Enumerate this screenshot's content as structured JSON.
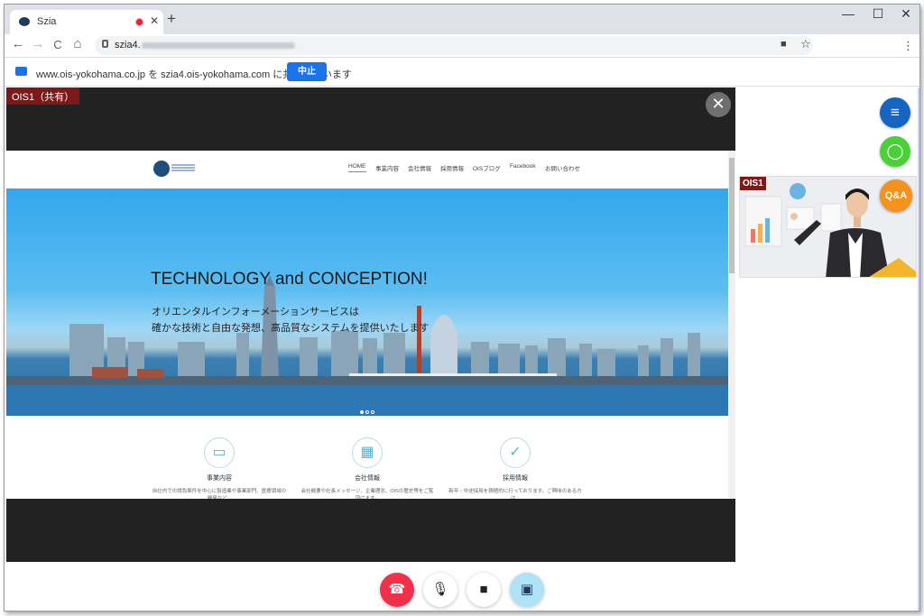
{
  "browser": {
    "tab_title": "Szia",
    "tab_close": "✕",
    "new_tab": "+",
    "url": "szia4.",
    "window_controls": [
      "—",
      "☐",
      "✕"
    ],
    "nav": {
      "back": "←",
      "forward": "→",
      "reload": "C",
      "home": "⌂"
    },
    "omnibox_icons": [
      "camera-icon",
      "star-icon"
    ],
    "menu": "⋮"
  },
  "sharing_bar": {
    "text": "www.ois-yokohama.co.jp を szia4.ois-yokohama.com に共有しています",
    "stop_label": "中止"
  },
  "stage": {
    "share_label": "OIS1（共有）",
    "close": "✕"
  },
  "website": {
    "nav_items": [
      "HOME",
      "事業内容",
      "会社情報",
      "採用情報",
      "OISブログ",
      "Facebook",
      "お問い合わせ"
    ],
    "hero_title": "TECHNOLOGY and CONCEPTION!",
    "hero_subtitle": "オリエンタルインフォーメーションサービスは\n確かな技術と自由な発想、高品質なシステムを提供いたします",
    "carousel_dots": 3,
    "features": [
      {
        "icon": "monitor-icon",
        "glyph": "▭",
        "label": "事業内容",
        "desc": "自社内での請負案件を中心に製造業や事業部門、医療領域の開発など..."
      },
      {
        "icon": "building-icon",
        "glyph": "▦",
        "label": "会社情報",
        "desc": "会社概要や社長メッセージ、企業理念、OISの歴史等をご覧頂けます。"
      },
      {
        "icon": "check-icon",
        "glyph": "✓",
        "label": "採用情報",
        "desc": "新卒・中途採用を積極的に行っております。ご興味のある方は..."
      }
    ]
  },
  "side_panel": {
    "menu_glyph": "≡",
    "chat_glyph": "◯",
    "video_label": "OIS1",
    "qa_label": "Q&A"
  },
  "controls": {
    "hangup_glyph": "☎",
    "mic_glyph": "🎙",
    "camera_glyph": "■",
    "screen_glyph": "▣"
  },
  "colors": {
    "hangup": "#f1304a",
    "share_accent": "#1a73e8",
    "label_bg": "#7c1a1a",
    "qa_badge": "#f5911d",
    "chat_fab": "#4cd03a",
    "menu_fab": "#1565c0"
  }
}
